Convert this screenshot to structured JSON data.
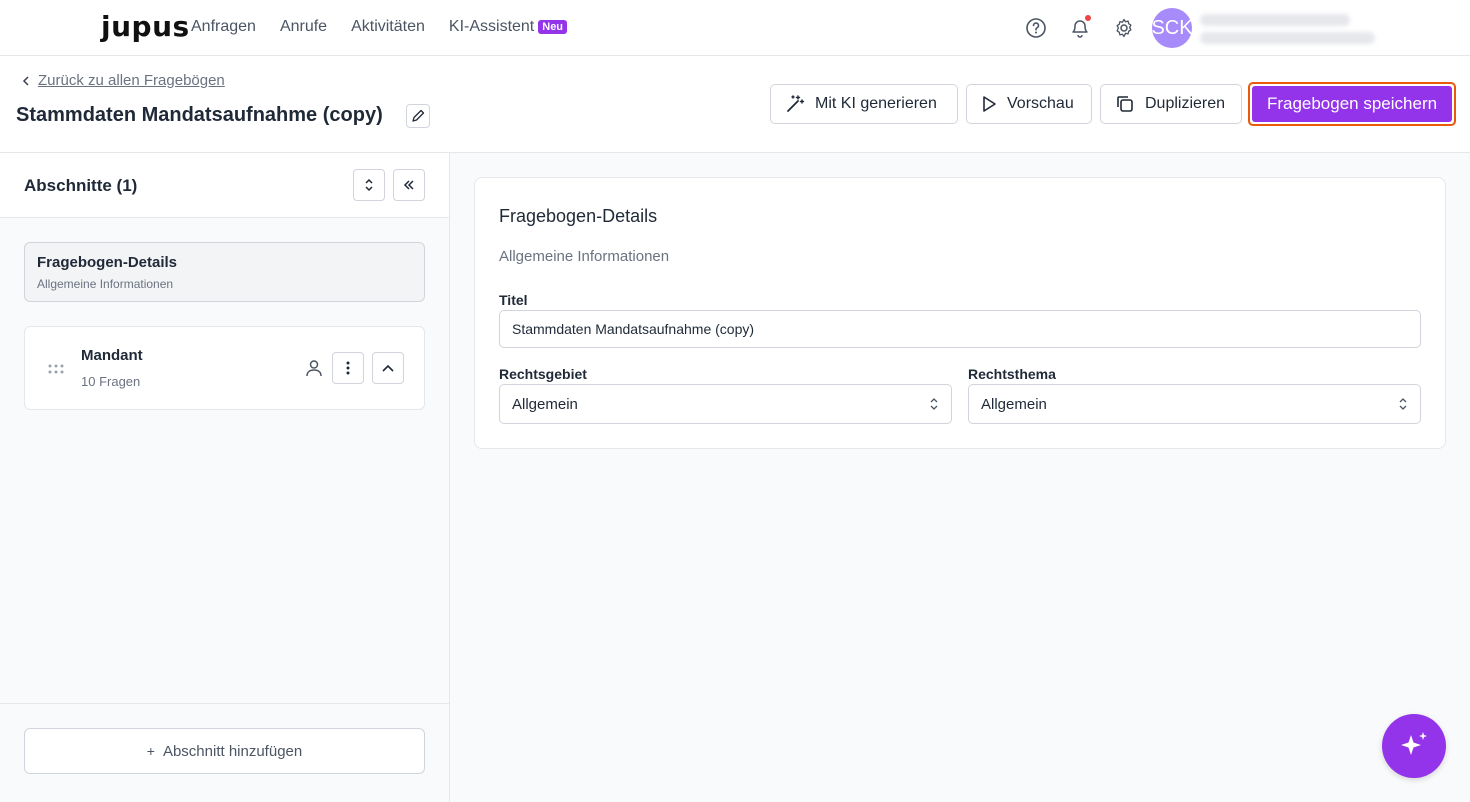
{
  "brand": {
    "logo": "jupus"
  },
  "nav": {
    "items": [
      {
        "label": "Anfragen"
      },
      {
        "label": "Anrufe"
      },
      {
        "label": "Aktivitäten"
      },
      {
        "label": "KI-Assistent",
        "badge": "Neu"
      }
    ]
  },
  "user": {
    "initials": "SCK"
  },
  "header": {
    "back_label": "Zurück zu allen Fragebögen",
    "title": "Stammdaten Mandatsaufnahme (copy)",
    "actions": {
      "ki": "Mit KI generieren",
      "preview": "Vorschau",
      "duplicate": "Duplizieren",
      "save": "Fragebogen speichern"
    }
  },
  "sidebar": {
    "title": "Abschnitte (1)",
    "details": {
      "title": "Fragebogen-Details",
      "subtitle": "Allgemeine Informationen"
    },
    "sections": [
      {
        "title": "Mandant",
        "count": "10 Fragen"
      }
    ],
    "add_label": "Abschnitt hinzufügen"
  },
  "form": {
    "title": "Fragebogen-Details",
    "subtitle": "Allgemeine Informationen",
    "titel_label": "Titel",
    "titel_value": "Stammdaten Mandatsaufnahme (copy)",
    "rechtsgebiet_label": "Rechtsgebiet",
    "rechtsgebiet_value": "Allgemein",
    "rechtsthema_label": "Rechtsthema",
    "rechtsthema_value": "Allgemein"
  },
  "colors": {
    "accent": "#9333ea",
    "save_outline": "#ea580c",
    "notification_dot": "#ef4444",
    "avatar": "#a78bfa"
  }
}
